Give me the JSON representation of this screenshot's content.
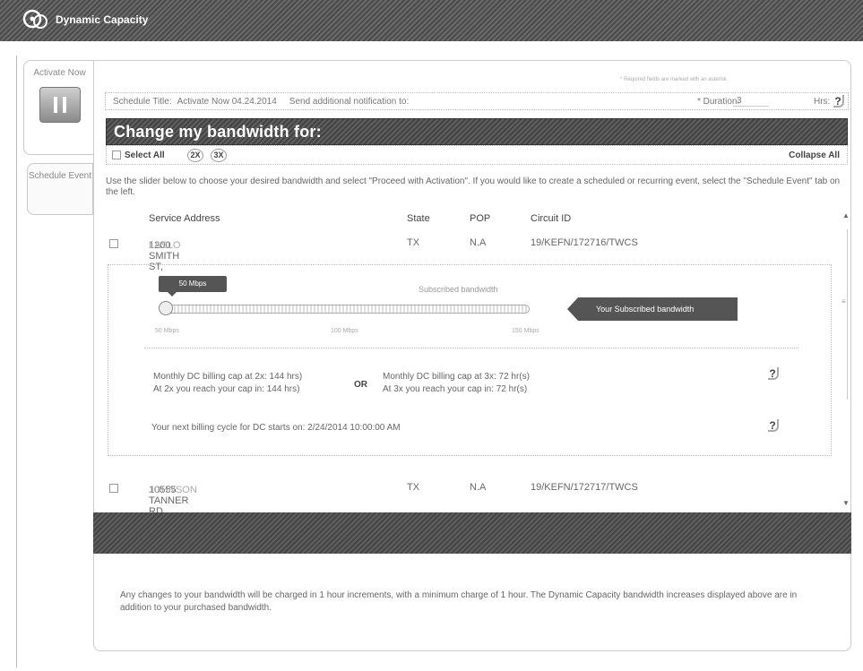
{
  "app": {
    "title": "Dynamic Capacity"
  },
  "tabs": [
    {
      "label": "Activate Now",
      "icon": "pause-icon"
    },
    {
      "label": "Schedule Event"
    }
  ],
  "required_note": "* Required fields are marked with an asterisk",
  "schedule": {
    "title_label": "Schedule Title:",
    "title_value": "Activate Now 04.24.2014",
    "notify_label": "Send additional notification to:",
    "duration_label": "* Duration:",
    "duration_value": "3",
    "hrs_label": "Hrs:"
  },
  "header": {
    "title": "Change my bandwidth for:"
  },
  "select_row": {
    "select_all_label": "Select All",
    "multiplier_2x": "2X",
    "multiplier_3x": "3X",
    "collapse_all_label": "Collapse All"
  },
  "instructions": "Use the slider below to choose your desired bandwidth and select \"Proceed with Activation\". If you would like to create a scheduled or recurring event, select the \"Schedule Event\" tab on the left.",
  "table": {
    "headers": {
      "address": "Service Address",
      "state": "State",
      "pop": "POP",
      "circuit": "Circuit ID"
    },
    "rows": [
      {
        "address": "1200 SMITH ST,",
        "city": "LASLO",
        "state": "TX",
        "pop": "N.A",
        "circuit": "19/KEFN/172716/TWCS"
      },
      {
        "address": "10555 TANNER RD,",
        "city": "JOHNSON",
        "state": "TX",
        "pop": "N.A",
        "circuit": "19/KEFN/172717/TWCS"
      }
    ]
  },
  "detail": {
    "slider_badge": "50 Mbps",
    "subscribed_label": "Subscribed bandwidth",
    "ticks": [
      "50 Mbps",
      "100 Mbps",
      "150 Mbps"
    ],
    "callout": "Your Subscribed bandwidth",
    "cap_2x_line1": "Monthly DC billing cap at 2x: 144 hrs)",
    "cap_2x_line2": "At 2x you reach your cap in: 144 hrs)",
    "or_label": "OR",
    "cap_3x_line1": "Monthly DC billing cap at 3x: 72 hr(s)",
    "cap_3x_line2": "At 3x you reach your cap in: 72 hr(s)",
    "next_billing": "Your next billing cycle for DC starts on: 2/24/2014 10:00:00 AM"
  },
  "footer": {
    "note": "Any changes to your bandwidth will be charged in 1 hour increments, with a minimum charge of 1 hour. The Dynamic Capacity bandwidth increases displayed above are in addition to your purchased bandwidth."
  },
  "help_symbol": "?",
  "colors": {
    "header_bar": "#4a4a4a",
    "callout": "#555555"
  }
}
